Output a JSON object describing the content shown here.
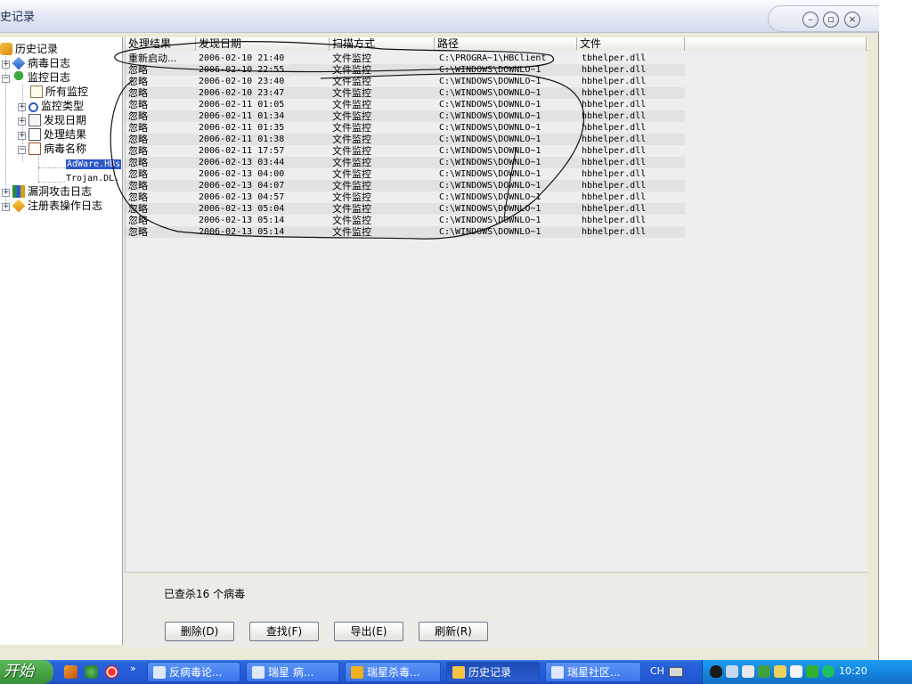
{
  "window": {
    "title": "史记录"
  },
  "tree": {
    "nodes": [
      {
        "label": "历史记录"
      },
      {
        "label": "病毒日志"
      },
      {
        "label": "监控日志"
      },
      {
        "label": "所有监控"
      },
      {
        "label": "监控类型"
      },
      {
        "label": "发现日期"
      },
      {
        "label": "处理结果"
      },
      {
        "label": "病毒名称"
      },
      {
        "label": "AdWare.HBs"
      },
      {
        "label": "Trojan.DL."
      },
      {
        "label": "漏洞攻击日志"
      },
      {
        "label": "注册表操作日志"
      }
    ]
  },
  "list": {
    "columns": [
      "处理结果",
      "发现日期",
      "扫描方式",
      "路径",
      "文件"
    ],
    "rows": [
      [
        "重新启动...",
        "2006-02-10 21:40",
        "文件监控",
        "C:\\PROGRA~1\\HBClient",
        "tbhelper.dll"
      ],
      [
        "忽略",
        "2006-02-10 22:55",
        "文件监控",
        "C:\\WINDOWS\\DOWNLO~1",
        "hbhelper.dll"
      ],
      [
        "忽略",
        "2006-02-10 23:40",
        "文件监控",
        "C:\\WINDOWS\\DOWNLO~1",
        "hbhelper.dll"
      ],
      [
        "忽略",
        "2006-02-10 23:47",
        "文件监控",
        "C:\\WINDOWS\\DOWNLO~1",
        "hbhelper.dll"
      ],
      [
        "忽略",
        "2006-02-11 01:05",
        "文件监控",
        "C:\\WINDOWS\\DOWNLO~1",
        "hbhelper.dll"
      ],
      [
        "忽略",
        "2006-02-11 01:34",
        "文件监控",
        "C:\\WINDOWS\\DOWNLO~1",
        "hbhelper.dll"
      ],
      [
        "忽略",
        "2006-02-11 01:35",
        "文件监控",
        "C:\\WINDOWS\\DOWNLO~1",
        "hbhelper.dll"
      ],
      [
        "忽略",
        "2006-02-11 01:38",
        "文件监控",
        "C:\\WINDOWS\\DOWNLO~1",
        "hbhelper.dll"
      ],
      [
        "忽略",
        "2006-02-11 17:57",
        "文件监控",
        "C:\\WINDOWS\\DOWNLO~1",
        "hbhelper.dll"
      ],
      [
        "忽略",
        "2006-02-13 03:44",
        "文件监控",
        "C:\\WINDOWS\\DOWNLO~1",
        "hbhelper.dll"
      ],
      [
        "忽略",
        "2006-02-13 04:00",
        "文件监控",
        "C:\\WINDOWS\\DOWNLO~1",
        "hbhelper.dll"
      ],
      [
        "忽略",
        "2006-02-13 04:07",
        "文件监控",
        "C:\\WINDOWS\\DOWNLO~1",
        "hbhelper.dll"
      ],
      [
        "忽略",
        "2006-02-13 04:57",
        "文件监控",
        "C:\\WINDOWS\\DOWNLO~1",
        "hbhelper.dll"
      ],
      [
        "忽略",
        "2006-02-13 05:04",
        "文件监控",
        "C:\\WINDOWS\\DOWNLO~1",
        "hbhelper.dll"
      ],
      [
        "忽略",
        "2006-02-13 05:14",
        "文件监控",
        "C:\\WINDOWS\\DOWNLO~1",
        "hbhelper.dll"
      ],
      [
        "忽略",
        "2006-02-13 05:14",
        "文件监控",
        "C:\\WINDOWS\\DOWNLO~1",
        "hbhelper.dll"
      ]
    ]
  },
  "summary": "已查杀16 个病毒",
  "buttons": {
    "delete": "删除(D)",
    "find": "查找(F)",
    "export": "导出(E)",
    "refresh": "刷新(R)"
  },
  "taskbar": {
    "start": "开始",
    "tasks": [
      "反病毒论...",
      "瑞星 病...",
      "瑞星杀毒...",
      "历史记录",
      "瑞星社区..."
    ],
    "lang": "CH",
    "clock": "10:20"
  },
  "colors": {
    "selection": "#2b56c8",
    "taskbar": "#245bd8",
    "tray": "#1585de",
    "start": "#378f37"
  }
}
